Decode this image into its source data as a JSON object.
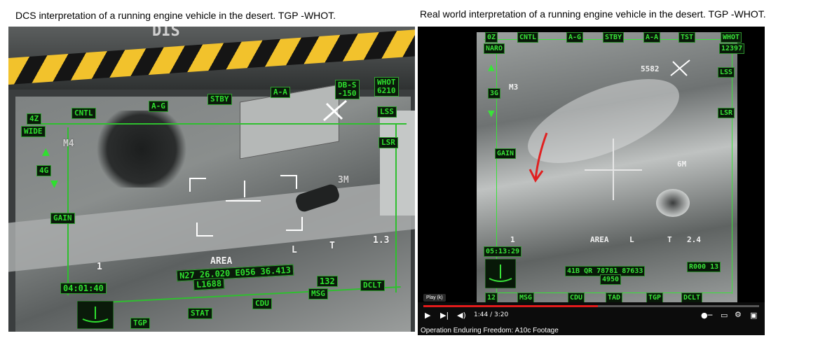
{
  "captions": {
    "left": "DCS interpretation of a running engine vehicle in the desert. TGP -WHOT.",
    "right": "Real world interpretation of a running engine vehicle in the desert. TGP -WHOT."
  },
  "dcs": {
    "bezel_label": "DIS",
    "top_buttons": [
      "4Z",
      "CNTL",
      "A-G",
      "STBY",
      "A-A",
      "DB-S\n-150",
      "WHOT\n6210"
    ],
    "left_labels": [
      "WIDE",
      "4G",
      "GAIN"
    ],
    "right_labels": [
      "LSS",
      "LSR"
    ],
    "markers": [
      "M4",
      "3M",
      "1",
      "AREA",
      "L",
      "T",
      "1.3"
    ],
    "time": "04:01:40",
    "coords_line1": "N27 26.020 E056 36.413",
    "coords_line2": "L1688",
    "coords_line3": "132",
    "bottom_buttons": [
      "TGP",
      "STAT",
      "CDU",
      "MSG",
      "DCLT"
    ]
  },
  "real": {
    "top_buttons": [
      "0Z",
      "CNTL",
      "A-G",
      "STBY",
      "A-A",
      "TST",
      "WHOT"
    ],
    "top_right_value": "12397",
    "top_left_label": "NARO",
    "left_labels": [
      "M3",
      "3G",
      "GAIN",
      "1"
    ],
    "right_labels": [
      "LSS",
      "LSR"
    ],
    "elevation": "5582",
    "markers": [
      "6M",
      "AREA",
      "L",
      "T",
      "2.4"
    ],
    "time": "05:13:29",
    "info_line1": "41B QR 78781 87633",
    "info_line2": "4950",
    "range": "R000 13",
    "bottom_buttons": [
      "12",
      "MSG",
      "CDU",
      "TAD",
      "TGP",
      "DCLT"
    ],
    "player": {
      "tooltip": "Play (k)",
      "time": "1:44 / 3:20",
      "progress": 0.52,
      "title": "Operation Enduring Freedom: A10c Footage"
    }
  }
}
